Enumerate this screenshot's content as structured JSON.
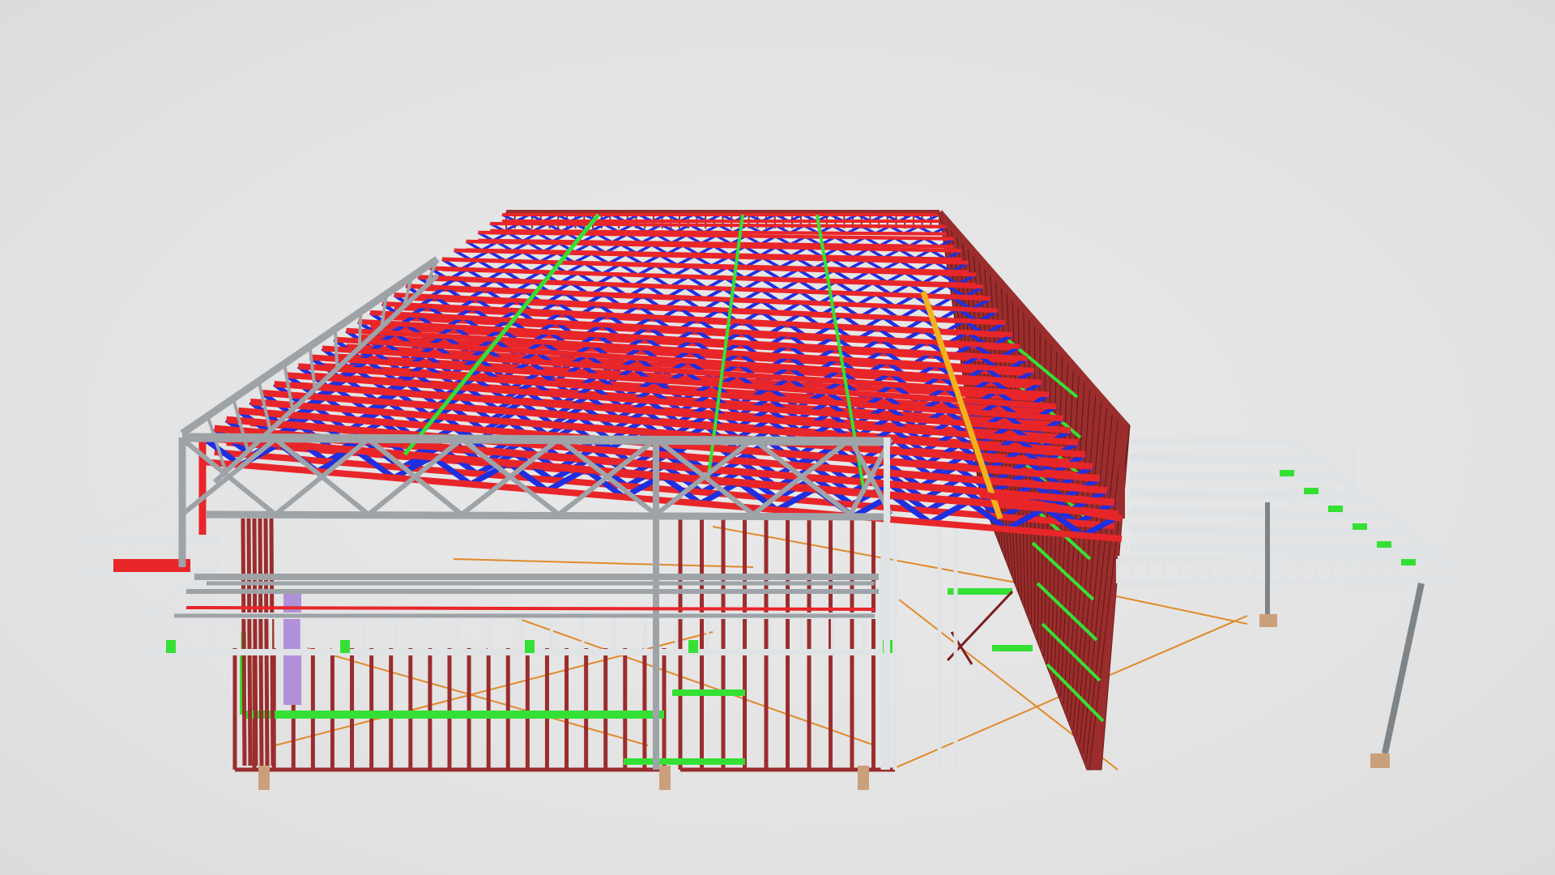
{
  "viewer": {
    "background_color": "#e4e4e4"
  },
  "model": {
    "member_colors": {
      "truss_chord": "#e8262a",
      "truss_web": "#1f2fe0",
      "wall_stud": "#9b2d2d",
      "bracing_block": "#35e035",
      "steel_girder": "#9ea3a8",
      "steel_frame_light": "#e0e3e5",
      "cable_brace": "#e08a2a",
      "header_beam": "#f2b21c",
      "column_steel": "#7f8488",
      "panel_purple": "#b090d8"
    }
  }
}
